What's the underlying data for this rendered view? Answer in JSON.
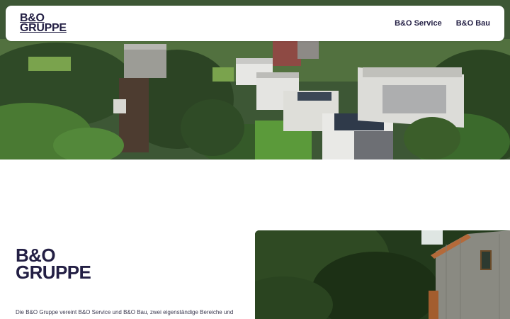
{
  "header": {
    "logo_line1": "B&O",
    "logo_line2": "GRUPPE",
    "nav": [
      {
        "label": "B&O Service"
      },
      {
        "label": "B&O Bau"
      }
    ]
  },
  "main": {
    "logo_line1": "B&O",
    "logo_line2": "GRUPPE",
    "intro_text": "Die B&O Gruppe vereint B&O Service und B&O Bau, zwei eigenständige Bereiche und"
  },
  "colors": {
    "brand": "#231f44",
    "background": "#ffffff"
  }
}
